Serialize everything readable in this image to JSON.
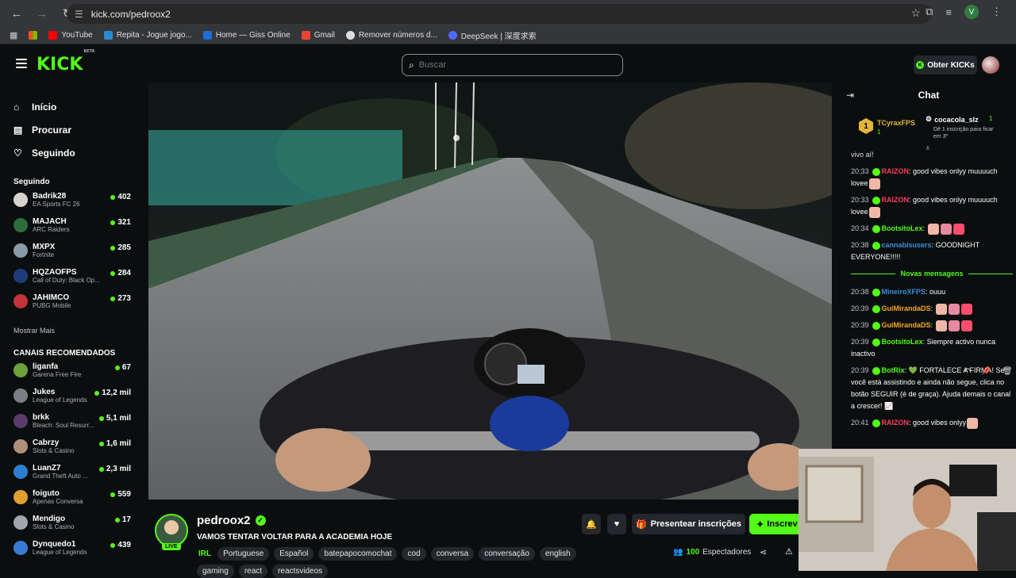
{
  "browser": {
    "url": "kick.com/pedroox2",
    "profile_initial": "V",
    "bookmarks": [
      "YouTube",
      "Repita - Jogue jogo...",
      "Home — Giss Online",
      "Gmail",
      "Remover números d...",
      "DeepSeek | 深度求索"
    ]
  },
  "header": {
    "logo": "KICK",
    "logo_tag": "BETA",
    "search_placeholder": "Buscar",
    "get_kicks": "Obter KICKs"
  },
  "sidebar": {
    "nav": [
      {
        "label": "Início",
        "icon": "home-icon"
      },
      {
        "label": "Procurar",
        "icon": "browse-icon"
      },
      {
        "label": "Seguindo",
        "icon": "heart-icon"
      }
    ],
    "following_title": "Seguindo",
    "following": [
      {
        "name": "Badrik28",
        "game": "EA Sports FC 26",
        "viewers": "402",
        "color": "#d8d2cf"
      },
      {
        "name": "MAJACH",
        "game": "ARC Raiders",
        "viewers": "321",
        "color": "#2b6e3b"
      },
      {
        "name": "MXPX",
        "game": "Fortnite",
        "viewers": "285",
        "color": "#8a9aa8"
      },
      {
        "name": "HQZAOFPS",
        "game": "Call of Duty: Black Op...",
        "viewers": "284",
        "color": "#1f3c7a"
      },
      {
        "name": "JAHIMCO",
        "game": "PUBG Mobile",
        "viewers": "273",
        "color": "#c4323a"
      }
    ],
    "show_more": "Mostrar Mais",
    "recommended_title": "CANAIS RECOMENDADOS",
    "recommended": [
      {
        "name": "liganfa",
        "game": "Garena Free Fire",
        "viewers": "67",
        "color": "#6aa33a"
      },
      {
        "name": "Jukes",
        "game": "League of Legends",
        "viewers": "12,2 mil",
        "color": "#7a7f86"
      },
      {
        "name": "brkk",
        "game": "Bleach: Soul Resurr...",
        "viewers": "5,1 mil",
        "color": "#5a3b6e"
      },
      {
        "name": "Cabrzy",
        "game": "Slots & Casino",
        "viewers": "1,6 mil",
        "color": "#b08f7a"
      },
      {
        "name": "LuanZ7",
        "game": "Grand Theft Auto ...",
        "viewers": "2,3 mil",
        "color": "#2d7fd0"
      },
      {
        "name": "foiguto",
        "game": "Apenas Conversa",
        "viewers": "559",
        "color": "#e0a030"
      },
      {
        "name": "Mendigo",
        "game": "Slots & Casino",
        "viewers": "17",
        "color": "#a5a5b0"
      },
      {
        "name": "Dynquedo1",
        "game": "League of Legends",
        "viewers": "439",
        "color": "#3a7bd5"
      }
    ]
  },
  "stream": {
    "streamer": "pedroox2",
    "live_label": "LIVE",
    "title": "VAMOS TENTAR VOLTAR PARA A ACADEMIA HOJE",
    "category": "IRL",
    "tags": [
      "Portuguese",
      "Español",
      "batepapocomochat",
      "cod",
      "conversa",
      "conversação",
      "english"
    ],
    "tags_row2": [
      "gaming",
      "react",
      "reactsvideos"
    ],
    "gift_label": "Presentear inscrições",
    "subscribe_label": "Inscrev",
    "viewers_count": "100",
    "viewers_label": "Espectadores"
  },
  "chat": {
    "title": "Chat",
    "pinned": {
      "rank": "1",
      "user1": "TCyraxFPS",
      "count1": "1",
      "user2": "cocacola_slz",
      "count2": "1",
      "desc": "Dê 1 inscrição para ficar em 3º"
    },
    "partial_top": "vivo aí!",
    "messages_before": [
      {
        "time": "20:33",
        "user": "RAIZON",
        "color": "#ff3b5c",
        "text": "good vibes onlyy muuuuch lovee",
        "badge": "badge"
      },
      {
        "time": "20:33",
        "user": "RAIZON",
        "color": "#ff3b5c",
        "text": "good vibes onlyy muuuuch lovee",
        "badge": "badge"
      },
      {
        "time": "20:34",
        "user": "BootsitoLex",
        "color": "#53fc18",
        "text": "",
        "badge": "badge"
      },
      {
        "time": "20:38",
        "user": "cannabisusers",
        "color": "#3a8dde",
        "text": "GOODNIGHT EVERYONE!!!!!",
        "badge": "badge"
      }
    ],
    "new_messages_label": "Novas mensagens",
    "messages_after": [
      {
        "time": "20:38",
        "user": "MineiroXFPS",
        "color": "#3a8dde",
        "text": "ouuu",
        "badge": "badge"
      },
      {
        "time": "20:39",
        "user": "GuiMirandaDS",
        "color": "#f5a623",
        "text": "",
        "badge": "badge"
      },
      {
        "time": "20:39",
        "user": "GuiMirandaDS",
        "color": "#f5a623",
        "text": "",
        "badge": "badge"
      },
      {
        "time": "20:39",
        "user": "BootsitoLex",
        "color": "#53fc18",
        "text": "Siempre activo nunca inactivo",
        "badge": "badge"
      },
      {
        "time": "20:39",
        "user": "BotRix",
        "color": "#53fc18",
        "text": "💚 FORTALECE A FIRMA! Se você está assistindo e ainda não segue, clica no botão SEGUIR (é de graça). Ajuda demais o canal a crescer! 📈",
        "badge": "badge"
      },
      {
        "time": "20:41",
        "user": "RAIZON",
        "color": "#ff3b5c",
        "text": "good vibes onlyy",
        "badge": "badge"
      }
    ]
  },
  "colors": {
    "accent": "#53fc18",
    "background": "#0b0e0f",
    "surface": "#24272c"
  }
}
